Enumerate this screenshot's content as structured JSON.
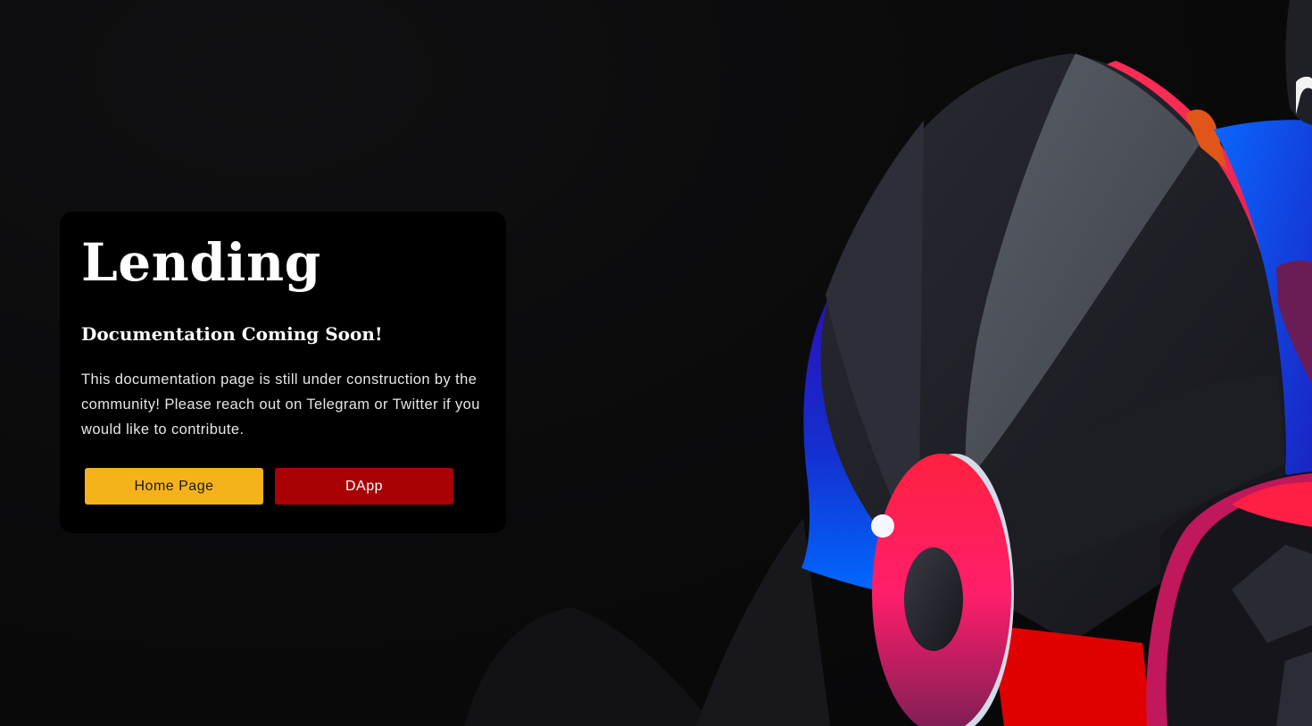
{
  "page": {
    "title": "Lending",
    "subtitle": "Documentation Coming Soon!",
    "body": "This documentation page is still under construction by the community! Please reach out on Telegram or Twitter if you would like to contribute."
  },
  "buttons": {
    "home_label": "Home Page",
    "dapp_label": "DApp"
  },
  "colors": {
    "home_button_bg": "#f5b21b",
    "dapp_button_bg": "#a80205",
    "card_bg": "#000000",
    "page_bg": "#0b0b0c",
    "art_pink": "#ff1e5a",
    "art_blue": "#0066ff",
    "art_red": "#e00000"
  },
  "illustration": {
    "icon": "abstract-mascot-illustration"
  }
}
